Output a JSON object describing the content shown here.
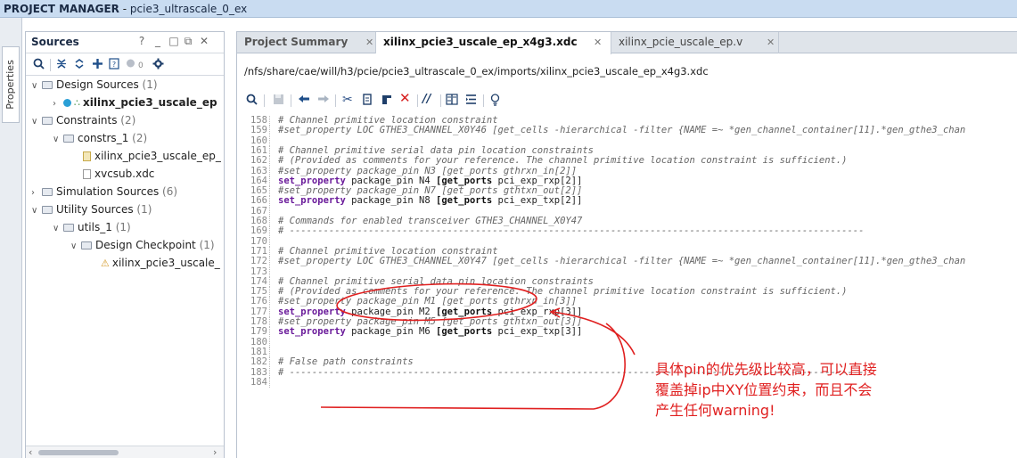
{
  "window": {
    "title_prefix": "PROJECT MANAGER",
    "title_separator": " - ",
    "project": "pcie3_ultrascale_0_ex"
  },
  "side_tab": {
    "label": "Properties"
  },
  "sources": {
    "title": "Sources",
    "help": "?",
    "icons": [
      "search-icon",
      "collapse-all-icon",
      "expand-all-icon",
      "add-icon",
      "info-icon",
      "status-dot-icon",
      "gear-icon"
    ],
    "status_count": "0",
    "tree": [
      {
        "label": "Design Sources",
        "count": "(1)"
      },
      {
        "label": "xilinx_pcie3_uscale_ep"
      },
      {
        "label": "Constraints",
        "count": "(2)"
      },
      {
        "label": "constrs_1",
        "count": "(2)"
      },
      {
        "label": "xilinx_pcie3_uscale_ep_"
      },
      {
        "label": "xvcsub.xdc"
      },
      {
        "label": "Simulation Sources",
        "count": "(6)"
      },
      {
        "label": "Utility Sources",
        "count": "(1)"
      },
      {
        "label": "utils_1",
        "count": "(1)"
      },
      {
        "label": "Design Checkpoint",
        "count": "(1)"
      },
      {
        "label": "xilinx_pcie3_uscale_"
      }
    ]
  },
  "editor": {
    "tabs": [
      {
        "label": "Project Summary"
      },
      {
        "label": "xilinx_pcie3_uscale_ep_x4g3.xdc",
        "active": true
      },
      {
        "label": "xilinx_pcie_uscale_ep.v"
      }
    ],
    "file_path": "/nfs/share/cae/will/h3/pcie/pcie3_ultrascale_0_ex/imports/xilinx_pcie3_uscale_ep_x4g3.xdc",
    "toolbar": [
      "search-icon",
      "save-icon",
      "undo-icon",
      "redo-icon",
      "cut-icon",
      "copy-icon",
      "paste-icon",
      "delete-icon",
      "comment-icon",
      "columns-icon",
      "indent-icon",
      "bulb-icon"
    ],
    "lines": [
      {
        "n": "158",
        "t": "# Channel primitive location constraint"
      },
      {
        "n": "159",
        "t": "#set_property LOC GTHE3_CHANNEL_X0Y46 [get_cells -hierarchical -filter {NAME =~ *gen_channel_container[11].*gen_gthe3_chan"
      },
      {
        "n": "160",
        "t": ""
      },
      {
        "n": "161",
        "t": "# Channel primitive serial data pin location constraints"
      },
      {
        "n": "162",
        "t": "# (Provided as comments for your reference. The channel primitive location constraint is sufficient.)"
      },
      {
        "n": "163",
        "t": "#set_property package_pin N3 [get_ports gthrxn_in[2]]"
      },
      {
        "n": "164",
        "k": "set_property",
        "t": " package_pin N4 ",
        "g": "[get_ports",
        "r": " pci_exp_rxp[2]]"
      },
      {
        "n": "165",
        "t": "#set_property package_pin N7 [get_ports gthtxn_out[2]]"
      },
      {
        "n": "166",
        "k": "set_property",
        "t": " package_pin N8 ",
        "g": "[get_ports",
        "r": " pci_exp_txp[2]]"
      },
      {
        "n": "167",
        "t": ""
      },
      {
        "n": "168",
        "t": "# Commands for enabled transceiver GTHE3_CHANNEL_X0Y47"
      },
      {
        "n": "169",
        "t": "# ------------------------------------------------------------------------------------------------------"
      },
      {
        "n": "170",
        "t": ""
      },
      {
        "n": "171",
        "t": "# Channel primitive location constraint"
      },
      {
        "n": "172",
        "t": "#set_property LOC GTHE3_CHANNEL_X0Y47 [get_cells -hierarchical -filter {NAME =~ *gen_channel_container[11].*gen_gthe3_chan"
      },
      {
        "n": "173",
        "t": ""
      },
      {
        "n": "174",
        "t": "# Channel primitive serial data pin location constraints"
      },
      {
        "n": "175",
        "t": "# (Provided as comments for your reference. The channel primitive location constraint is sufficient.)"
      },
      {
        "n": "176",
        "t": "#set_property package_pin M1 [get_ports gthrxn_in[3]]"
      },
      {
        "n": "177",
        "k": "set_property",
        "t": " package_pin M2 ",
        "g": "[get_ports",
        "r": " pci_exp_rxp[3]]"
      },
      {
        "n": "178",
        "t": "#set_property package_pin M5 [get_ports gthtxn_out[3]]"
      },
      {
        "n": "179",
        "k": "set_property",
        "t": " package_pin M6 ",
        "g": "[get_ports",
        "r": " pci_exp_txp[3]]"
      },
      {
        "n": "180",
        "t": ""
      },
      {
        "n": "181",
        "t": ""
      },
      {
        "n": "182",
        "t": "# False path constraints"
      },
      {
        "n": "183",
        "t": "# ------------------------------------------------------------------------------------------------------"
      },
      {
        "n": "184",
        "t": ""
      }
    ]
  },
  "annotation": {
    "color": "#e02020",
    "lines": [
      "具体pin的优先级比较高，可以直接",
      "覆盖掉ip中XY位置约束，而且不会",
      "产生任何warning!"
    ]
  }
}
